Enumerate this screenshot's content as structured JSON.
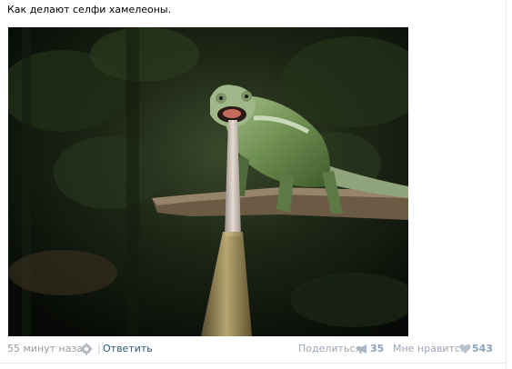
{
  "post": {
    "text": "Как делают селфи хамелеоны."
  },
  "footer": {
    "time": "55 минут назад",
    "separator": "|",
    "reply_label": "Ответить",
    "share_label": "Поделиться",
    "share_count": "35",
    "like_label": "Мне нравится",
    "like_count": "543"
  },
  "icons": {
    "settings": "gear-icon",
    "share": "megaphone-icon",
    "like": "heart-icon"
  },
  "colors": {
    "link": "#2b587a",
    "muted": "#999999",
    "action": "#9aa7b5",
    "count": "#8aa2ba"
  }
}
